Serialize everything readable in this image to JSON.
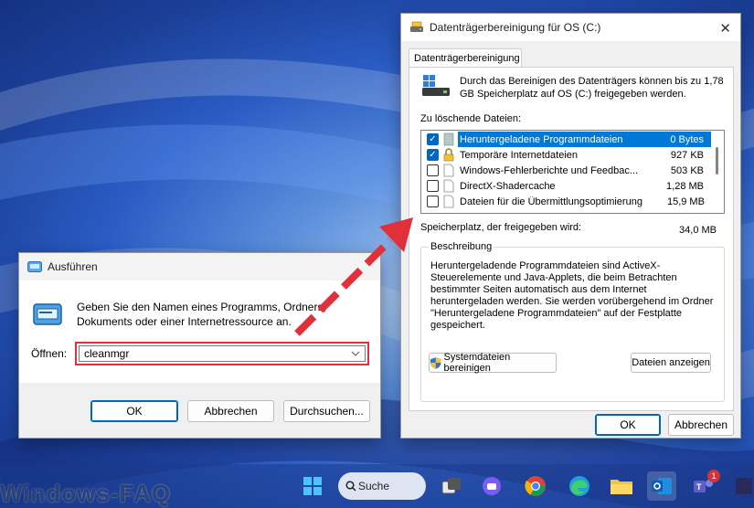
{
  "run_dialog": {
    "title": "Ausführen",
    "description": "Geben Sie den Namen eines Programms, Ordners, Dokuments oder einer Internetressource an.",
    "open_label": "Öffnen:",
    "input_value": "cleanmgr",
    "ok_label": "OK",
    "cancel_label": "Abbrechen",
    "browse_label": "Durchsuchen..."
  },
  "disk_cleanup": {
    "title": "Datenträgerbereinigung für OS (C:)",
    "tab_label": "Datenträgerbereinigung",
    "intro": "Durch das Bereinigen des Datenträgers können bis zu 1,78 GB Speicherplatz auf OS (C:) freigegeben werden.",
    "files_label": "Zu löschende Dateien:",
    "files": [
      {
        "name": "Heruntergeladene Programmdateien",
        "size": "0 Bytes",
        "checked": true,
        "selected": true,
        "icon": "folder-icon"
      },
      {
        "name": "Temporäre Internetdateien",
        "size": "927 KB",
        "checked": true,
        "selected": false,
        "icon": "lock-icon"
      },
      {
        "name": "Windows-Fehlerberichte und Feedbac...",
        "size": "503 KB",
        "checked": false,
        "selected": false,
        "icon": "file-icon"
      },
      {
        "name": "DirectX-Shadercache",
        "size": "1,28 MB",
        "checked": false,
        "selected": false,
        "icon": "file-icon"
      },
      {
        "name": "Dateien für die Übermittlungsoptimierung",
        "size": "15,9 MB",
        "checked": false,
        "selected": false,
        "icon": "file-icon"
      }
    ],
    "space_label": "Speicherplatz, der freigegeben wird:",
    "space_value": "34,0 MB",
    "description_legend": "Beschreibung",
    "description_text": "Heruntergeladende Programmdateien sind ActiveX-Steuerelemente und Java-Applets, die beim Betrachten bestimmter Seiten automatisch aus dem Internet heruntergeladen werden. Sie werden vorübergehend im Ordner \"Heruntergeladene Programmdateien\" auf der Festplatte gespeichert.",
    "clean_system_label": "Systemdateien bereinigen",
    "view_files_label": "Dateien anzeigen",
    "ok_label": "OK",
    "cancel_label": "Abbrechen"
  },
  "taskbar": {
    "search_label": "Suche",
    "teams_badge": "1"
  },
  "watermark": "Windows-FAQ",
  "colors": {
    "accent": "#0067c0",
    "highlight_border": "#e0303a",
    "arrow": "#e0303a"
  }
}
